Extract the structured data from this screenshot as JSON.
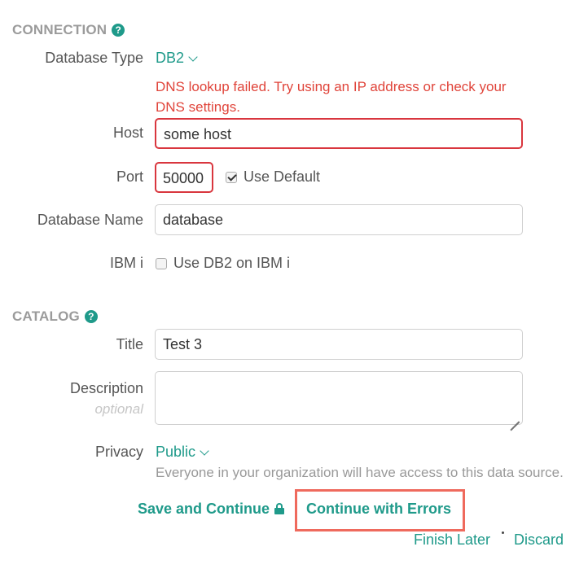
{
  "connection": {
    "section_title": "CONNECTION",
    "help_icon": "question-circle-icon",
    "database_type": {
      "label": "Database Type",
      "value": "DB2"
    },
    "error": "DNS lookup failed. Try using an IP address or check your DNS settings.",
    "host": {
      "label": "Host",
      "value": "some host"
    },
    "port": {
      "label": "Port",
      "value": "50000",
      "use_default_label": "Use Default",
      "use_default_checked": true
    },
    "database_name": {
      "label": "Database Name",
      "value": "database"
    },
    "ibm_i": {
      "label": "IBM i",
      "checkbox_label": "Use DB2 on IBM i",
      "checked": false
    }
  },
  "catalog": {
    "section_title": "CATALOG",
    "help_icon": "question-circle-icon",
    "title": {
      "label": "Title",
      "value": "Test 3"
    },
    "description": {
      "label": "Description",
      "sublabel": "optional",
      "value": ""
    },
    "privacy": {
      "label": "Privacy",
      "value": "Public",
      "helper": "Everyone in your organization will have access to this data source."
    }
  },
  "actions": {
    "save_and_continue": "Save and Continue",
    "continue_with_errors": "Continue with Errors",
    "finish_later": "Finish Later",
    "discard": "Discard"
  },
  "colors": {
    "accent": "#1f9a8a",
    "error": "#e0443a",
    "highlight": "#ef6a5d"
  }
}
